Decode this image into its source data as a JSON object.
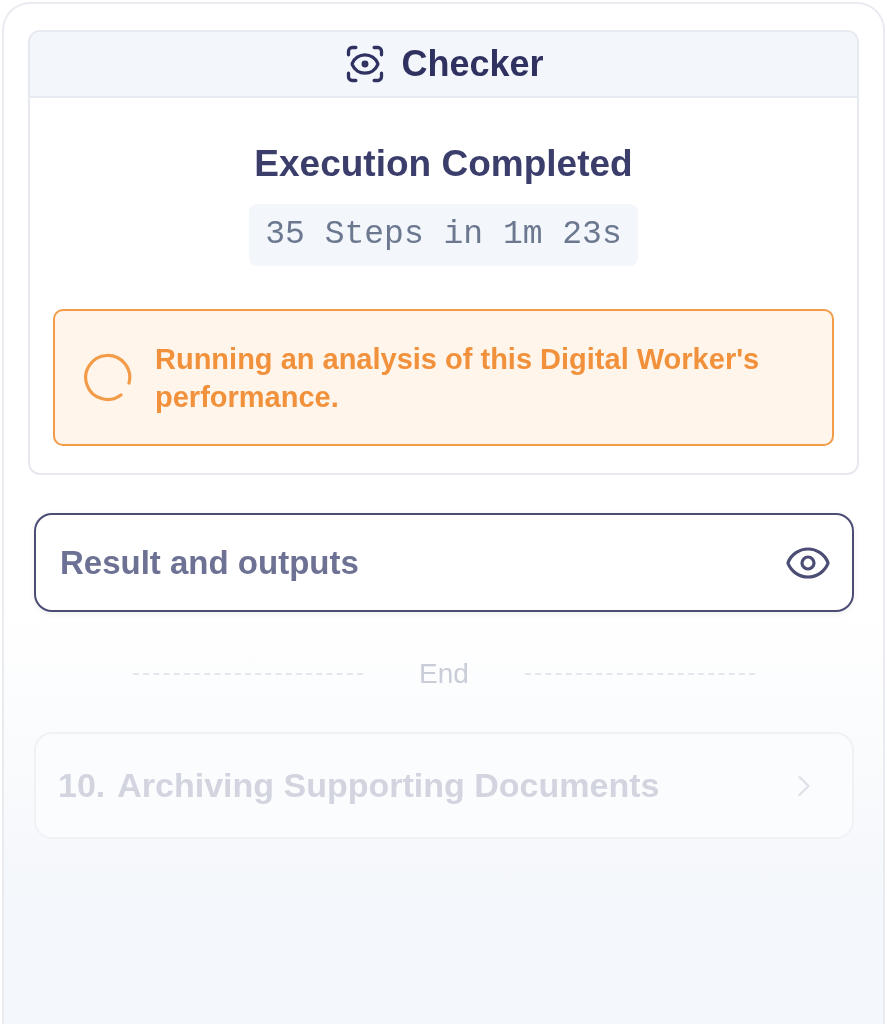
{
  "checker": {
    "title": "Checker",
    "status_title": "Execution Completed",
    "stats": "35 Steps in 1m 23s",
    "alert": {
      "text": "Running an analysis of this Digital Worker's performance."
    }
  },
  "result_button": {
    "label": "Result and outputs"
  },
  "divider": {
    "label": "End"
  },
  "steps": [
    {
      "number": "10.",
      "title": "Archiving Supporting Documents"
    }
  ]
}
